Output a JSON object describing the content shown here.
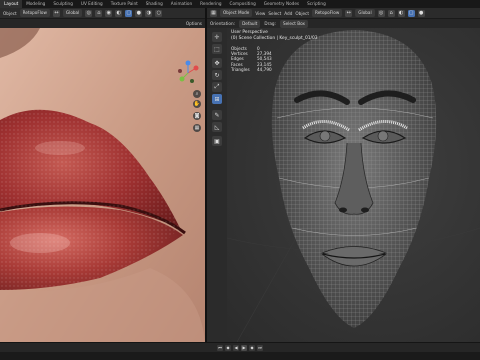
{
  "workspaces": [
    "Layout",
    "Modeling",
    "Sculpting",
    "UV Editing",
    "Texture Paint",
    "Shading",
    "Animation",
    "Rendering",
    "Compositing",
    "Geometry Nodes",
    "Scripting"
  ],
  "left_header": {
    "object_label": "Object",
    "object_mode": "RetopoFlow",
    "orientation": "Global",
    "options_label": "Options"
  },
  "right_header": {
    "mode": "Object Mode",
    "menu_items": [
      "View",
      "Select",
      "Add",
      "Object"
    ],
    "addon": "RetopoFlow",
    "orientation": "Global",
    "orientation_label": "Orientation:",
    "orientation_value": "Default",
    "drag_label": "Drag:",
    "drag_value": "Select Box"
  },
  "viewport_info": {
    "perspective": "User Perspective",
    "collection": "(0) Scene Collection | Key_sculpt_01/03"
  },
  "stats": [
    {
      "label": "Objects",
      "value": "0"
    },
    {
      "label": "Vertices",
      "value": "27,394"
    },
    {
      "label": "Edges",
      "value": "50,543"
    },
    {
      "label": "Faces",
      "value": "23,145"
    },
    {
      "label": "Triangles",
      "value": "44,790"
    }
  ],
  "tools": [
    "cursor-icon",
    "select-icon",
    "move-icon",
    "rotate-icon",
    "scale-icon",
    "transform-icon",
    "annotate-icon",
    "measure-icon",
    "add-cube-icon"
  ],
  "colors": {
    "accent": "#4772b3",
    "header": "#2b2b2b",
    "lip": "#9e3030",
    "skin": "#c49a86",
    "wire": "#cfcfcf"
  }
}
